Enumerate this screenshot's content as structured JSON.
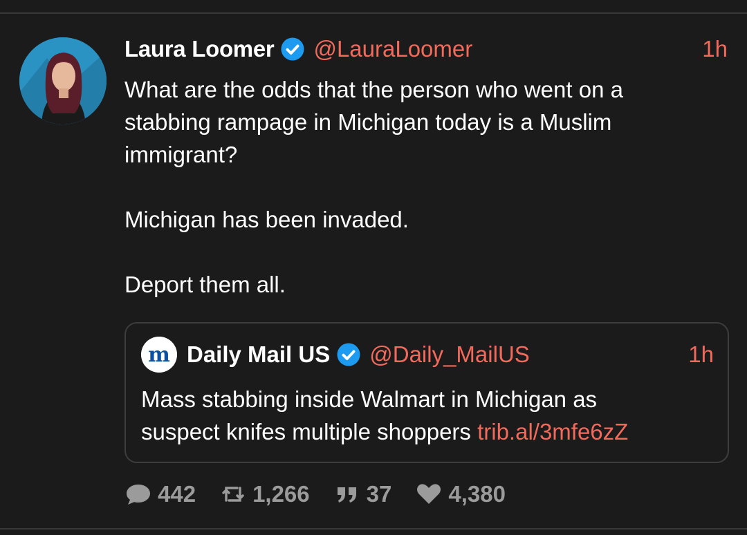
{
  "tweet": {
    "author_name": "Laura Loomer",
    "author_handle": "@LauraLoomer",
    "time": "1h",
    "lines": [
      "What are the odds that the person who went on a",
      "stabbing rampage in Michigan today is a Muslim",
      "immigrant?",
      "Michigan has been invaded.",
      "Deport them all."
    ]
  },
  "quoted": {
    "author_name": "Daily Mail US",
    "author_handle": "@Daily_MailUS",
    "time": "1h",
    "line1": "Mass stabbing inside Walmart in Michigan as",
    "line2": "suspect knifes multiple shoppers ",
    "link": "trib.al/3mfe6zZ",
    "logo_letter": "m"
  },
  "stats": {
    "replies": "442",
    "retweets": "1,266",
    "quotes": "37",
    "likes": "4,380"
  },
  "colors": {
    "background": "#1b1b1b",
    "accent": "#f26a5b",
    "verified": "#1d9bf0",
    "stat_text": "#9b9b9b"
  }
}
